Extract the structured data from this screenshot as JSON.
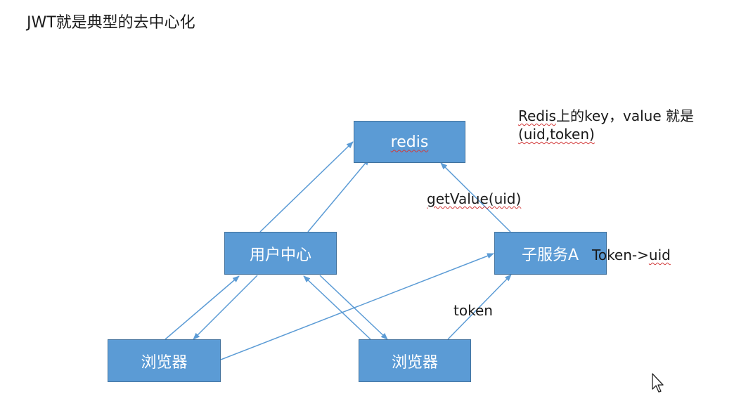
{
  "title": "JWT就是典型的去中心化",
  "nodes": {
    "redis": "redis",
    "user_center": "用户中心",
    "service_a": "子服务A",
    "browser_left": "浏览器",
    "browser_right": "浏览器"
  },
  "annotations": {
    "redis_note_line1_prefix": "Redis",
    "redis_note_line1_rest": "上的key，value   就是",
    "redis_note_line2": "(uid,token)",
    "get_value": "getValue(uid)",
    "token_to_uid_prefix": "Token->",
    "token_to_uid_suffix": "uid",
    "token": "token"
  },
  "colors": {
    "node_fill": "#5b9bd5",
    "node_border": "#41719c",
    "arrow": "#5b9bd5",
    "spell_underline": "#d23a3a"
  },
  "icons": {
    "cursor": "mouse-pointer-icon"
  }
}
